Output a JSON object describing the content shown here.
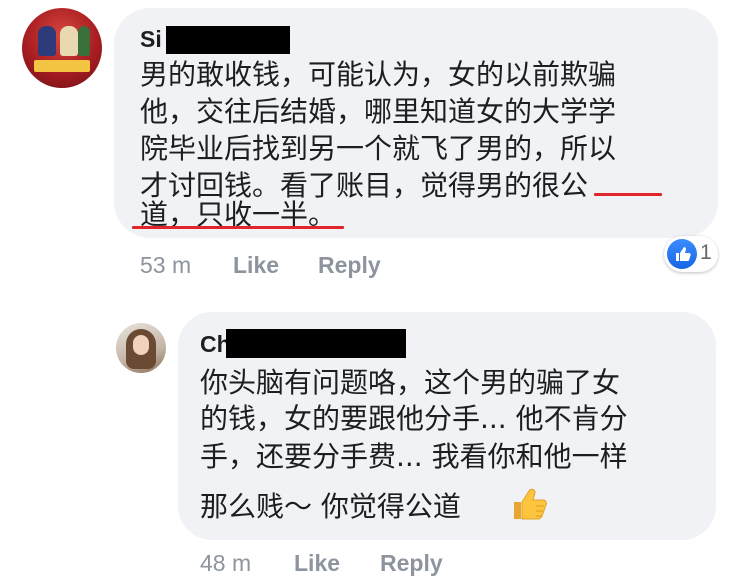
{
  "comments": [
    {
      "author_prefix": "Si",
      "lines": [
        "男的敢收钱，可能认为，女的以前欺骗",
        "他，交往后结婚，哪里知道女的大学学",
        "院毕业后找到另一个就飞了男的，所以",
        "才讨回钱。看了账目，觉得男的很公",
        "道，只收一半。"
      ],
      "time": "53 m",
      "like_label": "Like",
      "reply_label": "Reply",
      "reaction_count": "1",
      "underline_color": "#e0262b"
    },
    {
      "author_prefix": "Ch",
      "lines": [
        "你头脑有问题咯，这个男的骗了女",
        "的钱，女的要跟他分手... 他不肯分",
        "手，还要分手费... 我看你和他一样",
        "那么贱～ 你觉得公道"
      ],
      "emoji": "thumbs-up-icon",
      "time": "48 m",
      "like_label": "Like",
      "reply_label": "Reply"
    }
  ],
  "colors": {
    "bubble": "#f0f2f5",
    "meta_text": "#8d949e",
    "like_blue": "#1766e6"
  }
}
